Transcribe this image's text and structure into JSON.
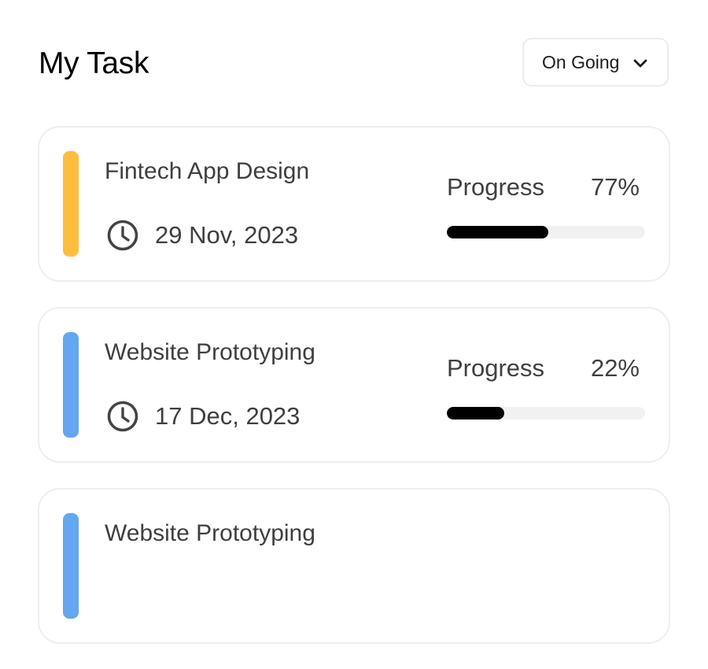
{
  "header": {
    "title": "My Task",
    "filter": {
      "selected": "On Going",
      "icon": "chevron-down-icon"
    }
  },
  "tasks": [
    {
      "title": "Fintech App Design",
      "date": "29 Nov, 2023",
      "progress_label": "Progress",
      "progress_text": "77%",
      "progress": 0.51,
      "accent_color": "#ffbd3d",
      "icon": "clock-icon"
    },
    {
      "title": "Website Prototyping",
      "date": "17 Dec, 2023",
      "progress_label": "Progress",
      "progress_text": "22%",
      "progress": 0.29,
      "accent_color": "#62a7ef",
      "icon": "clock-icon"
    },
    {
      "title": "Website Prototyping",
      "date": "",
      "progress_label": "",
      "progress_text": "",
      "progress": 0,
      "accent_color": "#62a7ef",
      "icon": "clock-icon"
    }
  ],
  "colors": {
    "progress_fill": "#000000",
    "progress_track": "#f1f1f1",
    "text": "#3f3f3f",
    "border": "#eeeeee"
  }
}
